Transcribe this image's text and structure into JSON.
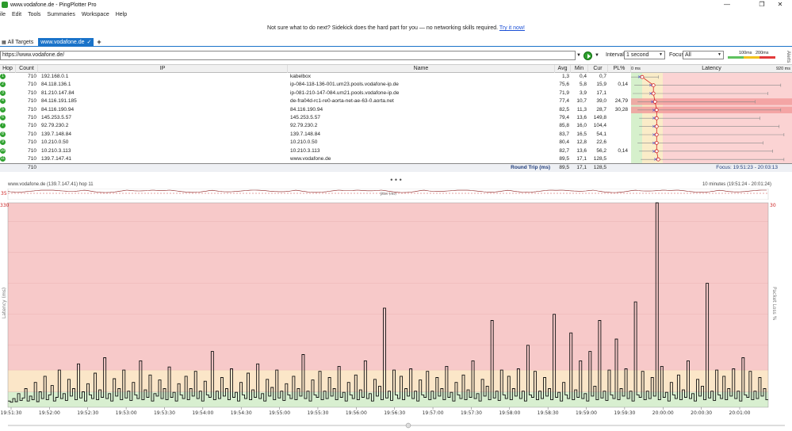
{
  "window": {
    "title": "www.vodafone.de - PingPlotter Pro",
    "controls": [
      "—",
      "❐",
      "✕"
    ]
  },
  "menu": [
    "ile",
    "Edit",
    "Tools",
    "Summaries",
    "Workspace",
    "Help"
  ],
  "promo": {
    "text": "Not sure what to do next? Sidekick does the hard part for you — no networking skills required.",
    "link": "Try it now!"
  },
  "tabs": {
    "all_targets": "All Targets",
    "active": "www.vodafone.de",
    "add": "+"
  },
  "toolbar": {
    "address": "https://www.vodafone.de/",
    "interval_label": "Interval",
    "interval_value": "1 second",
    "focus_label": "Focus",
    "focus_value": "All",
    "legend_100": "100ms",
    "legend_200": "200ms",
    "alerts": "Alerts"
  },
  "table": {
    "headers": {
      "hop": "Hop",
      "count": "Count",
      "ip": "IP",
      "name": "Name",
      "avg": "Avg",
      "min": "Min",
      "cur": "Cur",
      "pl": "PL%",
      "latency": "Latency"
    },
    "latency_scale_min": "0 ms",
    "latency_scale_max": "920 ms",
    "rows": [
      {
        "hop": "1",
        "count": "710",
        "ip": "192.168.0.1",
        "name": "kabelbox",
        "avg": "1,3",
        "min": "0,4",
        "cur": "0,7",
        "pl": "",
        "pct_min": 0.0,
        "pct_avg": 0.0,
        "pct_max": 0.17
      },
      {
        "hop": "2",
        "count": "710",
        "ip": "84.118.136.1",
        "name": "ip-084-118-136-001.um23.pools.vodafone-ip.de",
        "avg": "75,6",
        "min": "5,8",
        "cur": "15,9",
        "pl": "0,14",
        "pct_min": 0.02,
        "pct_avg": 0.07,
        "pct_max": 0.93
      },
      {
        "hop": "3",
        "count": "710",
        "ip": "81.210.147.84",
        "name": "ip-081-210-147-084.um21.pools.vodafone-ip.de",
        "avg": "71,9",
        "min": "3,9",
        "cur": "17,1",
        "pl": "",
        "pct_min": 0.01,
        "pct_avg": 0.07,
        "pct_max": 0.85
      },
      {
        "hop": "4",
        "count": "710",
        "ip": "84.116.191.185",
        "name": "de-fra04d-rc1-re0-aorta-net-ae-63-0.aorta.net",
        "avg": "77,4",
        "min": "10,7",
        "cur": "39,0",
        "pl": "24,79",
        "pct_min": 0.04,
        "pct_avg": 0.08,
        "pct_max": 0.77
      },
      {
        "hop": "5",
        "count": "710",
        "ip": "84.116.190.94",
        "name": "84.116.190.94",
        "avg": "82,5",
        "min": "11,3",
        "cur": "28,7",
        "pl": "30,28",
        "pct_min": 0.04,
        "pct_avg": 0.09,
        "pct_max": 0.93
      },
      {
        "hop": "6",
        "count": "710",
        "ip": "145.253.5.57",
        "name": "145.253.5.57",
        "avg": "79,4",
        "min": "13,6",
        "cur": "149,8",
        "pl": "",
        "pct_min": 0.05,
        "pct_avg": 0.09,
        "pct_max": 0.8
      },
      {
        "hop": "7",
        "count": "710",
        "ip": "92.79.230.2",
        "name": "92.79.230.2",
        "avg": "85,8",
        "min": "16,0",
        "cur": "104,4",
        "pl": "",
        "pct_min": 0.05,
        "pct_avg": 0.09,
        "pct_max": 0.92
      },
      {
        "hop": "8",
        "count": "710",
        "ip": "139.7.148.84",
        "name": "139.7.148.84",
        "avg": "83,7",
        "min": "16,5",
        "cur": "54,1",
        "pl": "",
        "pct_min": 0.05,
        "pct_avg": 0.09,
        "pct_max": 0.95
      },
      {
        "hop": "9",
        "count": "710",
        "ip": "10.210.0.50",
        "name": "10.210.0.50",
        "avg": "80,4",
        "min": "12,8",
        "cur": "22,6",
        "pl": "",
        "pct_min": 0.04,
        "pct_avg": 0.09,
        "pct_max": 0.82
      },
      {
        "hop": "10",
        "count": "710",
        "ip": "10.210.3.113",
        "name": "10.210.3.113",
        "avg": "82,7",
        "min": "13,6",
        "cur": "56,2",
        "pl": "0,14",
        "pct_min": 0.05,
        "pct_avg": 0.09,
        "pct_max": 0.88
      },
      {
        "hop": "11",
        "count": "710",
        "ip": "139.7.147.41",
        "name": "www.vodafone.de",
        "avg": "89,5",
        "min": "17,1",
        "cur": "128,5",
        "pl": "",
        "pct_min": 0.06,
        "pct_avg": 0.1,
        "pct_max": 0.95
      }
    ],
    "summary": {
      "count": "710",
      "label": "Round Trip (ms)",
      "avg": "89,5",
      "min": "17,1",
      "cur": "128,5",
      "focus": "Focus: 19:51:23 - 20:03:13"
    }
  },
  "splitter": "• • •",
  "chart": {
    "title": "www.vodafone.de (139.7.147.41) hop 11",
    "range": "10 minutes (19:51:24 - 20:01:24)",
    "mini_left": "35",
    "mini_label": "Jitter (ms)",
    "y_top_left": "330",
    "y_top_right": "30",
    "ylabel_left": "Latency (ms)",
    "ylabel_right": "Packet Loss %",
    "colors": {
      "good": "#d8efd0",
      "warn": "#fbe6c8",
      "bad": "#f7c9c9",
      "line": "#111111"
    }
  },
  "chart_data": {
    "type": "line",
    "title": "www.vodafone.de (139.7.147.41) hop 11",
    "xlabel": "",
    "ylabel": "Latency (ms)",
    "ylim": [
      0,
      330
    ],
    "x_ticks": [
      "19:51:30",
      "19:52:00",
      "19:52:30",
      "19:53:00",
      "19:53:30",
      "19:54:00",
      "19:54:30",
      "19:55:00",
      "19:55:30",
      "19:56:00",
      "19:56:30",
      "19:57:00",
      "19:57:30",
      "19:58:00",
      "19:58:30",
      "19:59:00",
      "19:59:30",
      "20:00:00",
      "20:00:30",
      "20:01:00"
    ],
    "series": [
      {
        "values": [
          10,
          8,
          14,
          9,
          22,
          11,
          15,
          30,
          10,
          18,
          12,
          40,
          9,
          25,
          14,
          50,
          12,
          20,
          35,
          10,
          16,
          60,
          14,
          22,
          11,
          45,
          18,
          30,
          12,
          70,
          15,
          25,
          10,
          38,
          20,
          14,
          55,
          12,
          28,
          16,
          80,
          14,
          22,
          10,
          46,
          18,
          30,
          12,
          60,
          15,
          26,
          11,
          40,
          20,
          14,
          75,
          12,
          28,
          16,
          52,
          10,
          22,
          18,
          44,
          14,
          30,
          12,
          65,
          16,
          24,
          10,
          38,
          20,
          14,
          50,
          12,
          30,
          18,
          58,
          14,
          26,
          10,
          42,
          20,
          16,
          90,
          12,
          26,
          14,
          48,
          18,
          30,
          12,
          62,
          16,
          24,
          10,
          40,
          20,
          14,
          55,
          12,
          28,
          16,
          70,
          14,
          22,
          10,
          45,
          18,
          32,
          12,
          60,
          15,
          26,
          11,
          38,
          20,
          14,
          50,
          12,
          30,
          18,
          85,
          14,
          26,
          10,
          44,
          20,
          16,
          58,
          12,
          26,
          14,
          48,
          18,
          30,
          12,
          66,
          16,
          24,
          10,
          40,
          20,
          14,
          52,
          12,
          28,
          16,
          75,
          14,
          22,
          10,
          45,
          18,
          34,
          12,
          160,
          15,
          26,
          11,
          60,
          20,
          14,
          50,
          12,
          30,
          18,
          62,
          14,
          26,
          10,
          44,
          20,
          16,
          58,
          12,
          26,
          14,
          48,
          18,
          30,
          12,
          66,
          16,
          24,
          10,
          40,
          20,
          14,
          52,
          12,
          28,
          16,
          75,
          14,
          22,
          10,
          45,
          18,
          34,
          12,
          140,
          15,
          26,
          11,
          60,
          20,
          14,
          50,
          12,
          30,
          18,
          62,
          14,
          26,
          10,
          100,
          20,
          16,
          58,
          12,
          26,
          14,
          48,
          18,
          30,
          12,
          150,
          16,
          24,
          10,
          40,
          20,
          14,
          120,
          12,
          28,
          16,
          75,
          14,
          22,
          10,
          90,
          18,
          34,
          12,
          140,
          15,
          26,
          11,
          60,
          20,
          14,
          110,
          12,
          30,
          18,
          62,
          14,
          26,
          10,
          170,
          20,
          16,
          58,
          12,
          26,
          14,
          48,
          18,
          330,
          12,
          66,
          16,
          24,
          10,
          40,
          20,
          14,
          52,
          12,
          28,
          16,
          75,
          14,
          22,
          10,
          45,
          18,
          34,
          12,
          200,
          15,
          26,
          11,
          60,
          20,
          14,
          50,
          12,
          30,
          18,
          62,
          14,
          26,
          10,
          80,
          20,
          16,
          58,
          12,
          26,
          14,
          48,
          18,
          30,
          12
        ]
      }
    ],
    "zones": [
      {
        "name": "good",
        "from": 0,
        "to": 25
      },
      {
        "name": "warn",
        "from": 25,
        "to": 60
      },
      {
        "name": "bad",
        "from": 60,
        "to": 330
      }
    ]
  }
}
